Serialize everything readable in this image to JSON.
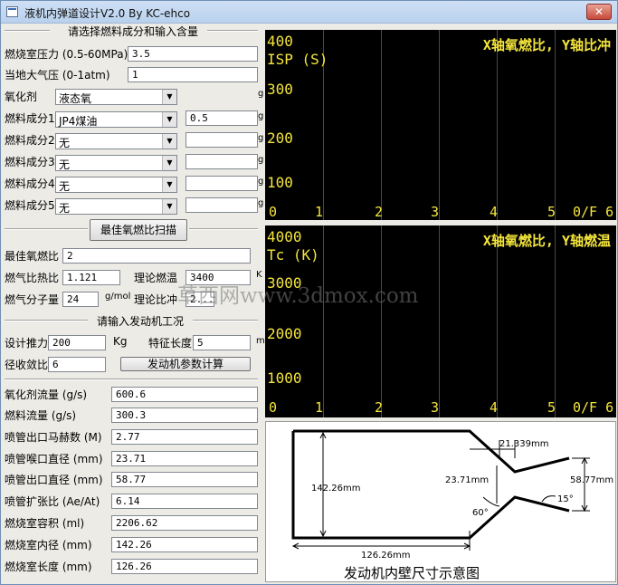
{
  "window": {
    "title": "液机内弹道设计V2.0 By KC-ehco",
    "close_symbol": "✕"
  },
  "fuel_section": {
    "header": "请选择燃料成分和输入含量",
    "chamber_pressure_label": "燃烧室压力 (0.5-60MPa)",
    "chamber_pressure_value": "3.5",
    "ambient_pressure_label": "当地大气压 (0-1atm)",
    "ambient_pressure_value": "1",
    "oxidizer_label": "氧化剂",
    "oxidizer_value": "液态氧",
    "oxidizer_unit": "g",
    "fuel1_label": "燃料成分1",
    "fuel1_value": "JP4煤油",
    "fuel1_amount": "0.5",
    "fuel1_unit": "g",
    "fuel2_label": "燃料成分2",
    "fuel2_value": "无",
    "fuel2_unit": "g",
    "fuel3_label": "燃料成分3",
    "fuel3_value": "无",
    "fuel3_unit": "g",
    "fuel4_label": "燃料成分4",
    "fuel4_value": "无",
    "fuel4_unit": "g",
    "fuel5_label": "燃料成分5",
    "fuel5_value": "无",
    "fuel5_unit": "g",
    "scan_button": "最佳氧燃比扫描"
  },
  "results1": {
    "best_ratio_label": "最佳氧燃比",
    "best_ratio_value": "2",
    "specific_heat_label": "燃气比热比",
    "specific_heat_value": "1.121",
    "theory_temp_label": "理论燃温",
    "theory_temp_value": "3400",
    "theory_temp_unit": "K",
    "molar_mass_label": "燃气分子量",
    "molar_mass_value": "24",
    "molar_mass_unit": "g/mol",
    "theory_isp_label": "理论比冲",
    "theory_isp_value": "2..."
  },
  "engine_section": {
    "header": "请输入发动机工况",
    "thrust_label": "设计推力",
    "thrust_value": "200",
    "thrust_unit": "Kg",
    "char_length_label": "特征长度",
    "char_length_value": "5",
    "char_length_unit": "m",
    "contraction_label": "径收敛比",
    "contraction_value": "6",
    "calc_button": "发动机参数计算"
  },
  "outputs": [
    {
      "label": "氧化剂流量 (g/s)",
      "value": "600.6"
    },
    {
      "label": "燃料流量 (g/s)",
      "value": "300.3"
    },
    {
      "label": "喷管出口马赫数 (M)",
      "value": "2.77"
    },
    {
      "label": "喷管喉口直径 (mm)",
      "value": "23.71"
    },
    {
      "label": "喷管出口直径 (mm)",
      "value": "58.77"
    },
    {
      "label": "喷管扩张比 (Ae/At)",
      "value": "6.14"
    },
    {
      "label": "燃烧室容积 (ml)",
      "value": "2206.62"
    },
    {
      "label": "燃烧室内径 (mm)",
      "value": "142.26"
    },
    {
      "label": "燃烧室长度 (mm)",
      "value": "126.26"
    }
  ],
  "plot1": {
    "title": "X轴氧燃比, Y轴比冲",
    "ylabel": "ISP (S)",
    "yticks": [
      "400",
      "300",
      "200",
      "100"
    ],
    "xticks": [
      "0",
      "1",
      "2",
      "3",
      "4",
      "5",
      "0/F 6"
    ]
  },
  "plot2": {
    "title": "X轴氧燃比, Y轴燃温",
    "ylabel": "Tc (K)",
    "yticks": [
      "4000",
      "3000",
      "2000",
      "1000"
    ],
    "xticks": [
      "0",
      "1",
      "2",
      "3",
      "4",
      "5",
      "0/F 6"
    ]
  },
  "diagram": {
    "caption": "发动机内壁尺寸示意图",
    "dim_chamber_diameter": "142.26mm",
    "dim_chamber_length": "126.26mm",
    "dim_throat_length": "21.339mm",
    "dim_throat_diameter": "23.71mm",
    "dim_exit_diameter": "58.77mm",
    "dim_converge_angle": "60°",
    "dim_diverge_angle": "15°"
  },
  "watermark": "草西网www.3dmox.com",
  "colors": {
    "plot_bg": "#000000",
    "plot_text": "#f5e63c",
    "grid": "#4a4a4a"
  }
}
